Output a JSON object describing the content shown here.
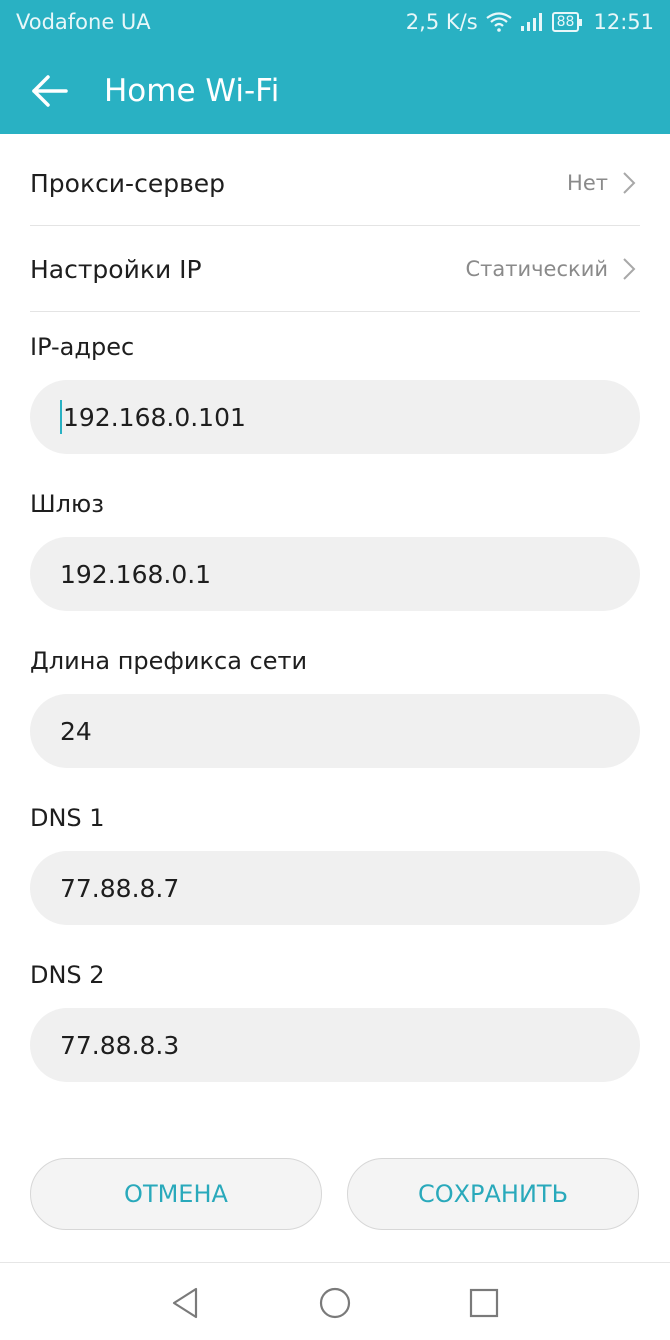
{
  "status_bar": {
    "carrier": "Vodafone UA",
    "speed": "2,5 K/s",
    "battery": "88",
    "time": "12:51",
    "icons": [
      "wifi-icon",
      "signal-icon",
      "battery-icon"
    ]
  },
  "app_bar": {
    "title": "Home Wi-Fi",
    "back_icon": "arrow-left-icon"
  },
  "rows": {
    "proxy": {
      "label": "Прокси-сервер",
      "value": "Нет"
    },
    "ip_settings": {
      "label": "Настройки IP",
      "value": "Статический"
    }
  },
  "fields": {
    "ip_address": {
      "label": "IP-адрес",
      "value": "192.168.0.101"
    },
    "gateway": {
      "label": "Шлюз",
      "value": "192.168.0.1"
    },
    "prefix": {
      "label": "Длина префикса сети",
      "value": "24"
    },
    "dns1": {
      "label": "DNS 1",
      "value": "77.88.8.7"
    },
    "dns2": {
      "label": "DNS 2",
      "value": "77.88.8.3"
    }
  },
  "buttons": {
    "cancel": "ОТМЕНА",
    "save": "СОХРАНИТЬ"
  },
  "nav_bar": {
    "icons": [
      "nav-back-icon",
      "nav-home-icon",
      "nav-recent-icon"
    ]
  },
  "colors": {
    "accent": "#29b1c3",
    "button_text": "#29a9bb",
    "field_bg": "#f0f0f0"
  }
}
